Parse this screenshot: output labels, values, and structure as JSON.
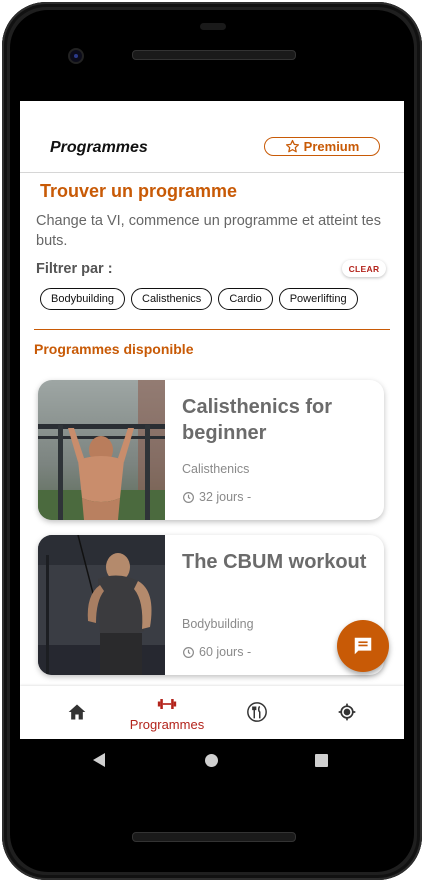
{
  "appbar": {
    "title": "Programmes",
    "premium_label": "Premium"
  },
  "search": {
    "title": "Trouver un programme",
    "description": "Change ta VI, commence un programme et atteint tes buts.",
    "filter_label": "Filtrer par :",
    "clear_label": "CLEAR",
    "filters": [
      "Bodybuilding",
      "Calisthenics",
      "Cardio",
      "Powerlifting"
    ]
  },
  "programs": {
    "section_title": "Programmes disponible",
    "items": [
      {
        "title": "Calisthenics for beginner",
        "category": "Calisthenics",
        "duration": "32 jours -"
      },
      {
        "title": "The CBUM workout",
        "category": "Bodybuilding",
        "duration": "60 jours -"
      }
    ]
  },
  "bottom_nav": {
    "items": [
      {
        "label": "",
        "icon": "home-icon"
      },
      {
        "label": "Programmes",
        "icon": "dumbbell-icon",
        "active": true
      },
      {
        "label": "",
        "icon": "food-icon"
      },
      {
        "label": "",
        "icon": "location-icon"
      }
    ]
  },
  "colors": {
    "accent": "#c85a06",
    "active_nav": "#b3231b"
  }
}
